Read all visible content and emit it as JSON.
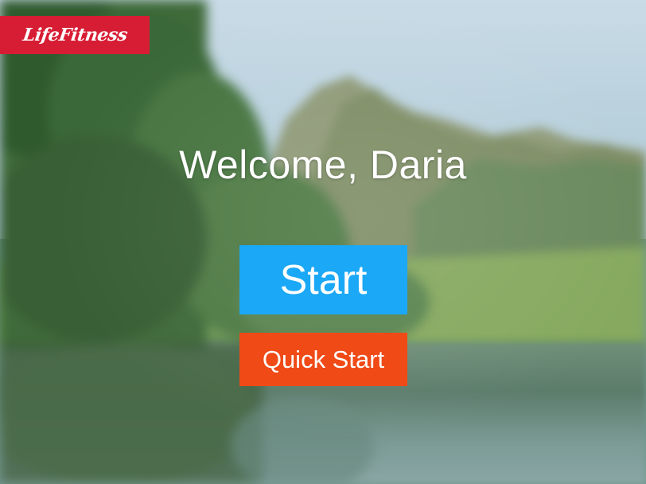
{
  "brand": {
    "logo_text": "LifeFitness",
    "logo_color": "#d71d34"
  },
  "welcome": {
    "text": "Welcome, Daria"
  },
  "actions": {
    "start_label": "Start",
    "start_color": "#1ba8f6",
    "quick_start_label": "Quick Start",
    "quick_start_color": "#f04a16"
  }
}
